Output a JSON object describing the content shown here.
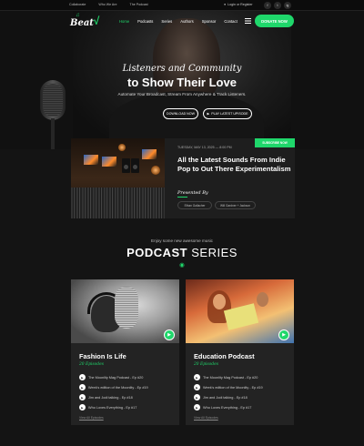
{
  "topbar": {
    "links": [
      "Collaborate",
      "Who We Are",
      "The Podcast"
    ],
    "login": "Login or Register",
    "socials": [
      "f",
      "t",
      "ig"
    ]
  },
  "nav": {
    "logo": "Beat",
    "menu": [
      "Home",
      "Podcasts",
      "Series",
      "Authors",
      "Sponsor",
      "Contact"
    ],
    "active_index": 0,
    "donate": "DONATE NOW",
    "accent_color": "#1fd76b"
  },
  "hero": {
    "tagline": "Listeners and Community",
    "headline": "to Show Their Love",
    "subtitle": "Automate Your Broadcast, Stream From Anywhere & Track Listeners.",
    "btn_download": "DOWNLOAD NOW",
    "btn_play": "PLAY LATEST UPISODE"
  },
  "episode": {
    "date": "TUESDAY, MAY 13, 2025 — 8:00 PM",
    "badge": "SUBSCRIBE NOW",
    "title": "All the Latest Sounds From Indie Pop to Out There Experimentalism",
    "presented": "Presented By",
    "hosts": [
      "Ethan Gallacher",
      "Will Gardner + Jackson"
    ]
  },
  "section": {
    "subtitle": "Enjoy some new awesome music",
    "title_bold": "PODCAST",
    "title_rest": " SERIES"
  },
  "cards": [
    {
      "title": "Fashion Is Life",
      "count": "20 Episodes",
      "items": [
        "The Moonlity Mag Podcast - Ep #20",
        "Week's edition of the Moonlity - Ep #19",
        "Jim and Jodi talking - Ep #18",
        "Who Loves Everything - Ep #17"
      ],
      "all": "View All Episodes"
    },
    {
      "title": "Education Podcast",
      "count": "20 Episodes",
      "items": [
        "The Moonlity Mag Podcast - Ep #20",
        "Week's edition of the Moonlity - Ep #19",
        "Jim and Jodi talking - Ep #18",
        "Who Loves Everything - Ep #17"
      ],
      "all": "View All Episodes"
    }
  ]
}
